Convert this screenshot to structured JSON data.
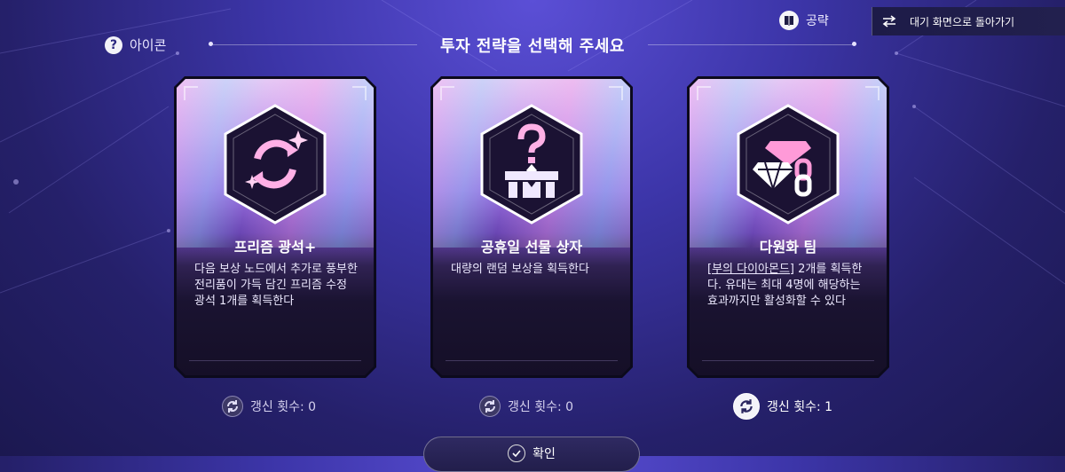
{
  "header": {
    "help_label": "아이콘",
    "title": "투자 전략을 선택해 주세요",
    "guide_label": "공략",
    "back_label": "대기 화면으로 돌아가기"
  },
  "cards": [
    {
      "name": "프리즘 광석+",
      "icon": "prism-refresh-icon",
      "description": "다음 보상 노드에서 추가로 풍부한 전리품이 가득 담긴 프리즘 수정 광석 1개를 획득한다",
      "refresh_label": "갱신 횟수: 0"
    },
    {
      "name": "공휴일 선물 상자",
      "icon": "mystery-gift-box-icon",
      "description": "대량의 랜덤 보상을 획득한다",
      "refresh_label": "갱신 횟수: 0"
    },
    {
      "name": "다원화 팀",
      "icon": "diamond-chain-icon",
      "description_link": "[부의 다이아몬드]",
      "description": " 2개를 획득한다. 유대는 최대 4명에 해당하는 효과까지만 활성화할 수 있다",
      "refresh_label": "갱신 횟수: 1"
    }
  ],
  "confirm_label": "확인",
  "colors": {
    "background_top": "#5b4fd6",
    "background_bottom": "#1b1850",
    "card_dark": "#150f27",
    "accent_pink": "#ff9ad8"
  }
}
